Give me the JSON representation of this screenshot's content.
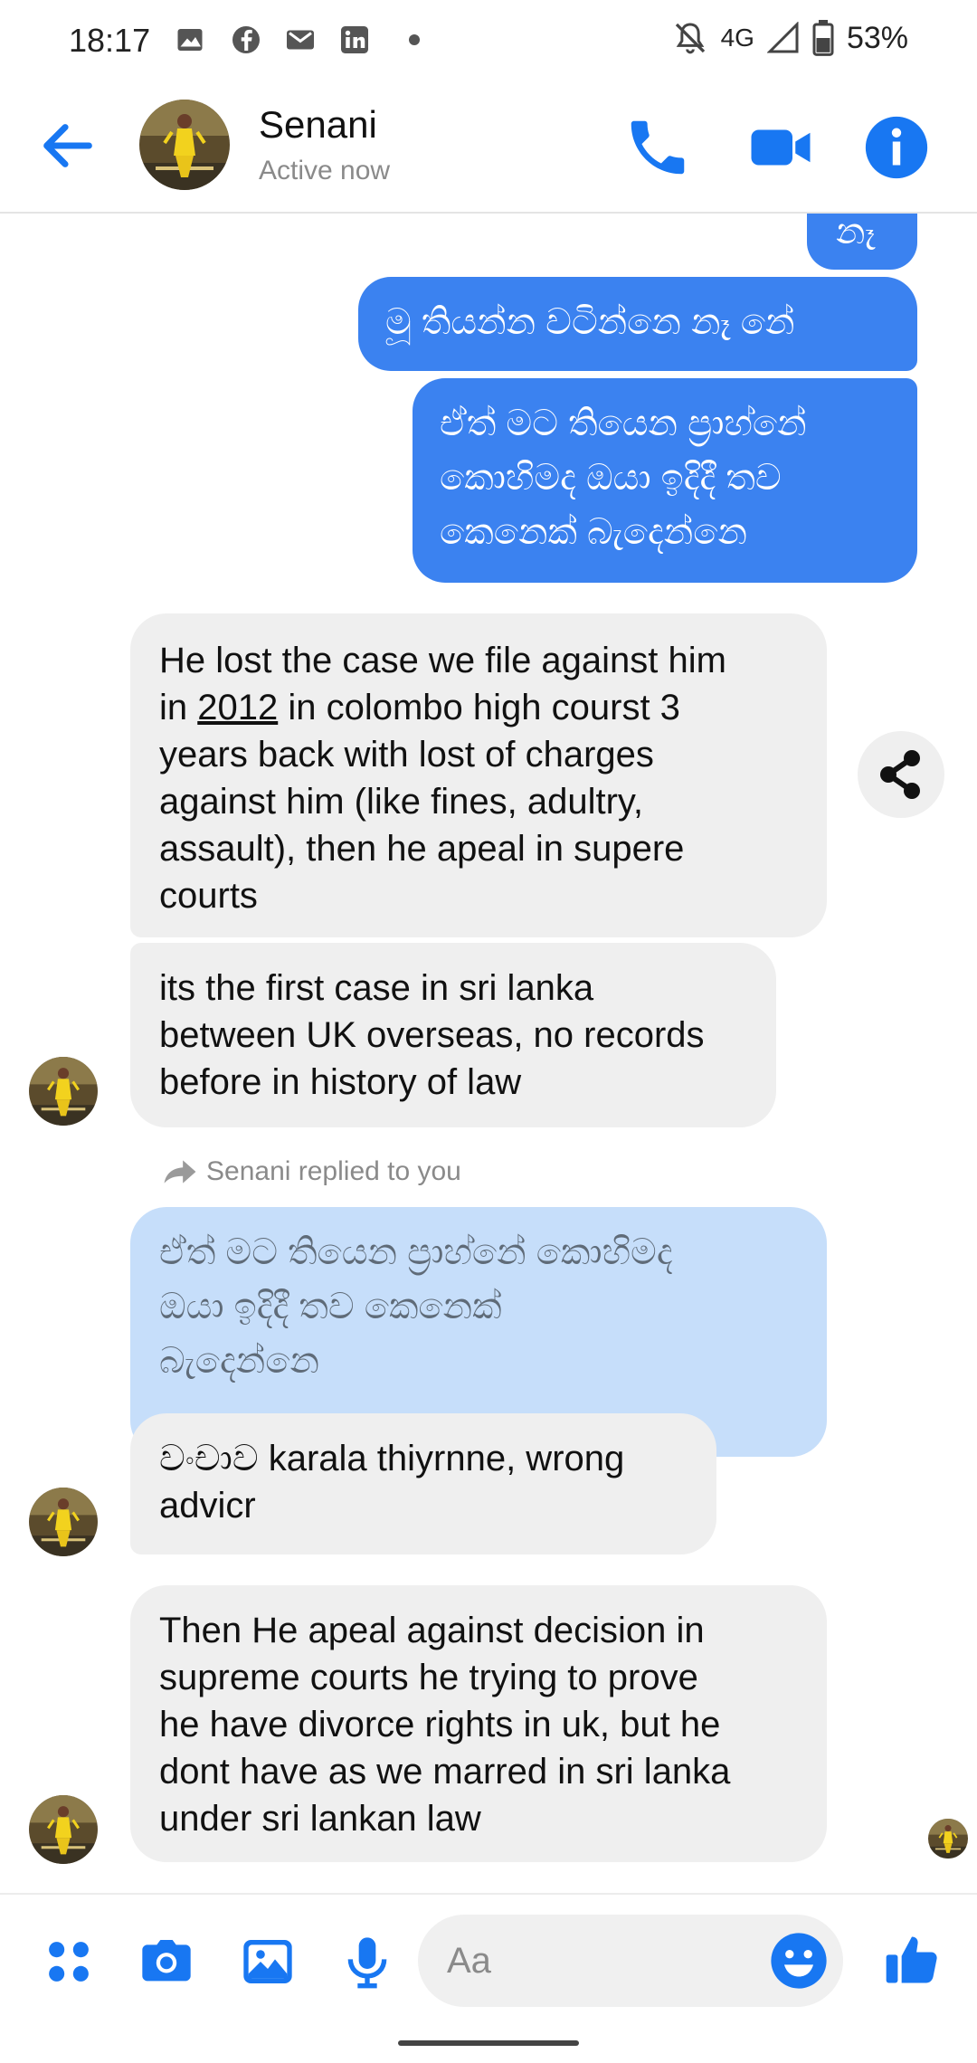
{
  "status_bar": {
    "time": "18:17",
    "network": "4G",
    "battery": "53%",
    "icons": [
      "image-icon",
      "facebook-icon",
      "gmail-icon",
      "linkedin-icon",
      "dot-icon",
      "mute-icon",
      "signal-icon",
      "battery-icon"
    ]
  },
  "header": {
    "name": "Senani",
    "status": "Active now",
    "accent_color": "#1877f2"
  },
  "messages": {
    "m0": "නෑ",
    "m1": "මූ තියන්න වටින්නෙ නෑ නේ",
    "m2": [
      "ඒත් මට තියෙන ප්‍රාහ්නේ",
      "කොහිමද ඔයා ඉදිදී තව",
      "කෙනෙක් බැදෙන්නෙ"
    ],
    "m3": {
      "l1": "He lost the case we file against him",
      "l2_pre": "in ",
      "l2_year": "2012",
      "l2_post": " in colombo high courst 3",
      "l3": "years back with lost of charges",
      "l4": "against him (like fines, adultry,",
      "l5": "assault), then he apeal in supere",
      "l6": "courts"
    },
    "m4": [
      "its the first case in sri lanka",
      "between UK overseas, no records",
      "before in history of law"
    ],
    "reply_note": "Senani replied to you",
    "quoted": [
      "ඒත් මට තියෙන ප්‍රාහ්නේ කොහිමද",
      "ඔයා ඉදිදී තව කෙනෙක්",
      "බැදෙන්නෙ"
    ],
    "m5": [
      "වංචාව karala thiyrnne, wrong",
      "advicr"
    ],
    "m6": [
      "Then He apeal against decision in",
      "supreme courts he trying to prove",
      "he have divorce rights in uk, but he",
      "dont have as we marred in sri lanka",
      "under sri lankan law"
    ]
  },
  "composer": {
    "placeholder": "Aa",
    "icons": [
      "menu-dots-icon",
      "camera-icon",
      "gallery-icon",
      "microphone-icon",
      "emoji-icon",
      "like-icon"
    ]
  },
  "colors": {
    "outgoing_bubble": "#3b82f0",
    "incoming_bubble": "#efefef",
    "quoted_bubble": "#c6defa"
  }
}
